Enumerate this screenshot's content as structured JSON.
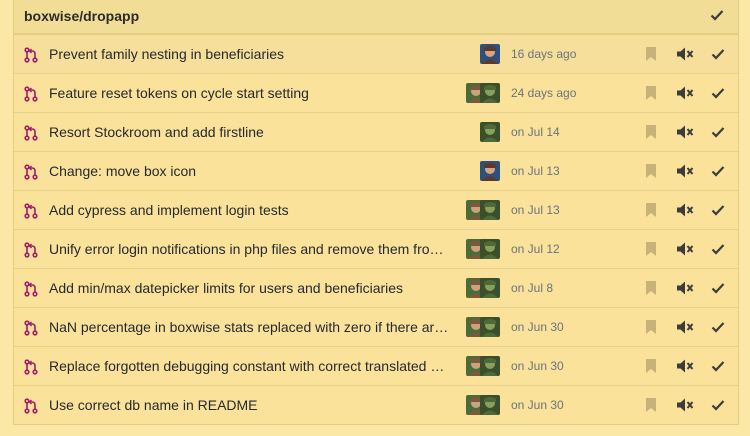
{
  "repo": {
    "name": "boxwise/dropapp"
  },
  "colors": {
    "pr_icon": "#9e1c6e",
    "meta": "#6a737d",
    "bookmark": "#c7b27a",
    "action": "#3c3c3c"
  },
  "notifications": [
    {
      "title": "Prevent family nesting in beneficiaries",
      "time": "16 days ago",
      "avatars": [
        "avatar-person-a"
      ]
    },
    {
      "title": "Feature reset tokens on cycle start setting",
      "time": "24 days ago",
      "avatars": [
        "avatar-person-b",
        "avatar-person-c"
      ]
    },
    {
      "title": "Resort Stockroom and add firstline",
      "time": "on Jul 14",
      "avatars": [
        "avatar-person-c"
      ]
    },
    {
      "title": "Change: move box icon",
      "time": "on Jul 13",
      "avatars": [
        "avatar-person-a"
      ]
    },
    {
      "title": "Add cypress and implement login tests",
      "time": "on Jul 13",
      "avatars": [
        "avatar-person-b",
        "avatar-person-c"
      ]
    },
    {
      "title": "Unify error login notifications in php files and remove them fro…",
      "time": "on Jul 12",
      "avatars": [
        "avatar-person-b",
        "avatar-person-c"
      ]
    },
    {
      "title": "Add min/max datepicker limits for users and beneficiaries",
      "time": "on Jul 8",
      "avatars": [
        "avatar-person-b",
        "avatar-person-c"
      ]
    },
    {
      "title": "NaN percentage in boxwise stats replaced with zero if there ar…",
      "time": "on Jun 30",
      "avatars": [
        "avatar-person-b",
        "avatar-person-c"
      ]
    },
    {
      "title": "Replace forgotten debugging constant with correct translated …",
      "time": "on Jun 30",
      "avatars": [
        "avatar-person-b",
        "avatar-person-c"
      ]
    },
    {
      "title": "Use correct db name in README",
      "time": "on Jun 30",
      "avatars": [
        "avatar-person-b",
        "avatar-person-c"
      ]
    }
  ]
}
